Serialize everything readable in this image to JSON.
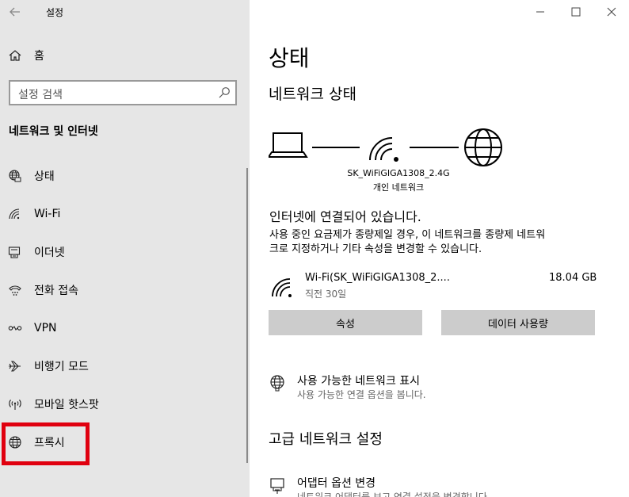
{
  "window": {
    "title": "설정"
  },
  "sidebar": {
    "home_label": "홈",
    "search_placeholder": "설정 검색",
    "section_title": "네트워크 및 인터넷",
    "items": [
      {
        "label": "상태",
        "icon": "globe-status-icon"
      },
      {
        "label": "Wi-Fi",
        "icon": "wifi-icon"
      },
      {
        "label": "이더넷",
        "icon": "ethernet-icon"
      },
      {
        "label": "전화 접속",
        "icon": "dialup-icon"
      },
      {
        "label": "VPN",
        "icon": "vpn-icon"
      },
      {
        "label": "비행기 모드",
        "icon": "airplane-icon"
      },
      {
        "label": "모바일 핫스팟",
        "icon": "hotspot-icon"
      },
      {
        "label": "프록시",
        "icon": "globe-icon"
      }
    ],
    "highlight_color": "#e0000f"
  },
  "main": {
    "title": "상태",
    "subtitle": "네트워크 상태",
    "ssid": "SK_WiFiGIGA1308_2.4G",
    "network_type": "개인 네트워크",
    "connection_status": "인터넷에 연결되어 있습니다.",
    "connection_desc_line1": "사용 중인 요금제가 종량제일 경우, 이 네트워크를 종량제 네트워",
    "connection_desc_line2": "크로 지정하거나 기타 속성을 변경할 수 있습니다.",
    "wifi_name": "Wi-Fi(SK_WiFiGIGA1308_2....",
    "wifi_time": "직전 30일",
    "wifi_usage": "18.04 GB",
    "btn_properties": "속성",
    "btn_data_usage": "데이터 사용량",
    "show_networks_title": "사용 가능한 네트워크 표시",
    "show_networks_desc": "사용 가능한 연결 옵션을 봅니다.",
    "advanced_title": "고급 네트워크 설정",
    "adapter_title": "어댑터 옵션 변경",
    "adapter_desc": "네트워크 어댑터를 보고 연결 설정을 변경합니다."
  }
}
